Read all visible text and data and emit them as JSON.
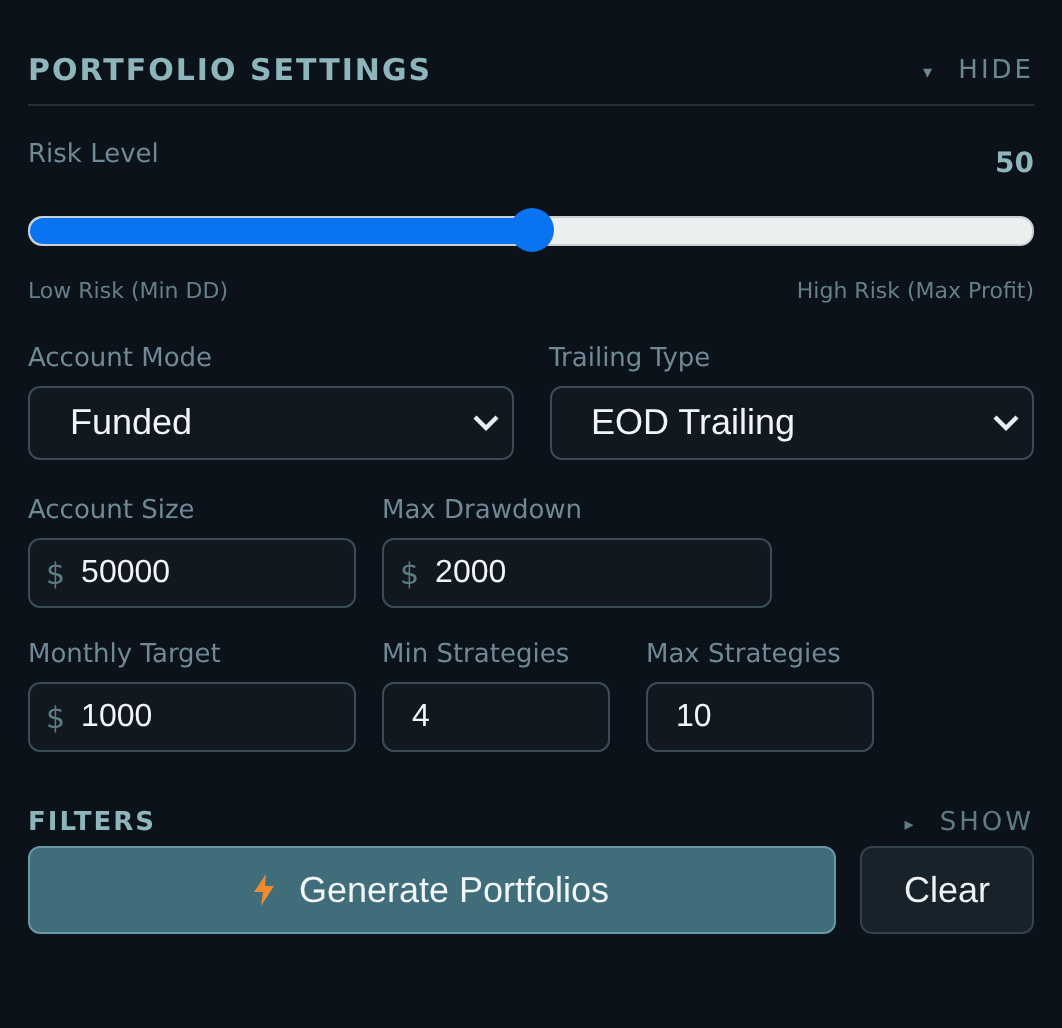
{
  "sections": [
    {
      "title": "PORTFOLIO SETTINGS",
      "toggle_icon": "▾",
      "toggle": "HIDE",
      "expanded": true
    },
    {
      "title": "FILTERS",
      "toggle_icon": "▸",
      "toggle": "SHOW",
      "expanded": false
    }
  ],
  "risk": {
    "label": "Risk Level",
    "value": "50",
    "level": 0.5,
    "min_label": "Low Risk (Min DD)",
    "max_label": "High Risk (Max Profit)"
  },
  "field_rows": [
    [
      {
        "kind": "select",
        "label": "Account Mode",
        "value": "Funded"
      },
      {
        "kind": "select",
        "label": "Trailing Type",
        "value": "EOD Trailing"
      }
    ],
    [
      {
        "kind": "input",
        "label": "Account Size",
        "prefix": "$",
        "value": "50000"
      },
      {
        "kind": "input",
        "label": "Max Drawdown",
        "prefix": "$",
        "value": "2000"
      }
    ],
    [
      {
        "kind": "input",
        "label": "Monthly Target",
        "prefix": "$",
        "value": "1000"
      },
      {
        "kind": "input",
        "label": "Min Strategies",
        "value": "4"
      },
      {
        "kind": "input",
        "label": "Max Strategies",
        "value": "10"
      }
    ]
  ],
  "buttons": [
    {
      "kind": "primary",
      "label": "Generate Portfolios"
    },
    {
      "kind": "secondary",
      "label": "Clear"
    }
  ]
}
